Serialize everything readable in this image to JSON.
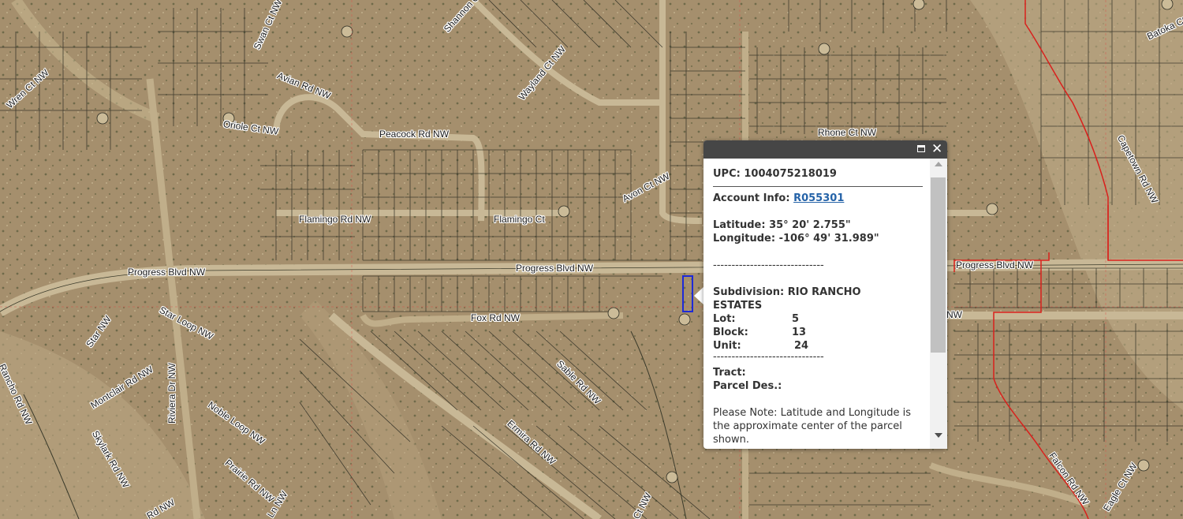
{
  "map": {
    "road_labels": [
      {
        "text": "Wren Ct NW"
      },
      {
        "text": "Swan Ct NW"
      },
      {
        "text": "Avian Rd NW"
      },
      {
        "text": "Shannon Ct NW"
      },
      {
        "text": "Wayland Ct NW"
      },
      {
        "text": "Oriole Ct NW"
      },
      {
        "text": "Peacock Rd NW"
      },
      {
        "text": "Rhone Ct NW"
      },
      {
        "text": "Avon Ct NW"
      },
      {
        "text": "Flamingo Rd NW"
      },
      {
        "text": "Flamingo Ct"
      },
      {
        "text": "Progress Blvd NW"
      },
      {
        "text": "Progress Blvd NW"
      },
      {
        "text": "Progress Blvd NW"
      },
      {
        "text": "Star Loop NW"
      },
      {
        "text": "Star NW"
      },
      {
        "text": "Fox Rd NW"
      },
      {
        "text": "Sable Rd NW"
      },
      {
        "text": "Montclair Rd NW"
      },
      {
        "text": "Skylark Rd NW"
      },
      {
        "text": "Riviera Dr NW"
      },
      {
        "text": "Noble Loop NW"
      },
      {
        "text": "Prairie Rd NW"
      },
      {
        "text": "Ermira Rd NW"
      },
      {
        "text": "Rancho Rd NW"
      },
      {
        "text": "Capetown Rd NW"
      },
      {
        "text": "Batoka Ct"
      },
      {
        "text": "Falcon Rd NW"
      },
      {
        "text": "Eagle Ct NW"
      },
      {
        "text": "Ct NW"
      },
      {
        "text": "Ln NW"
      },
      {
        "text": "Rd NW"
      },
      {
        "text": "NW"
      }
    ]
  },
  "popup": {
    "upc_label": "UPC:",
    "upc_value": "1004075218019",
    "account_label": "Account Info:",
    "account_value": "R055301",
    "latitude_label": "Latitude:",
    "latitude_value": "35° 20' 2.755\"",
    "longitude_label": "Longitude:",
    "longitude_value": "-106° 49' 31.989\"",
    "separator": "------------------------------",
    "subdivision_label": "Subdivision:",
    "subdivision_value_line1": "RIO RANCHO",
    "subdivision_value_line2": "ESTATES",
    "lot_label": "Lot:",
    "lot_value": "5",
    "block_label": "Block:",
    "block_value": "13",
    "unit_label": "Unit:",
    "unit_value": "24",
    "tract_label": "Tract:",
    "parcel_des_label": "Parcel Des.:",
    "note_line1": "Please Note: Latitude and Longitude is",
    "note_line2": "the approximate center of the parcel",
    "note_line3": "shown."
  },
  "colors": {
    "popup_header": "#464646",
    "selected_parcel": "#1d2ad8",
    "boundary_red": "#d9201c",
    "link": "#2563a8"
  },
  "icons": {
    "maximize": "maximize-icon",
    "close": "close-icon",
    "scroll_up": "scroll-up-arrow-icon",
    "scroll_down": "scroll-down-arrow-icon"
  }
}
